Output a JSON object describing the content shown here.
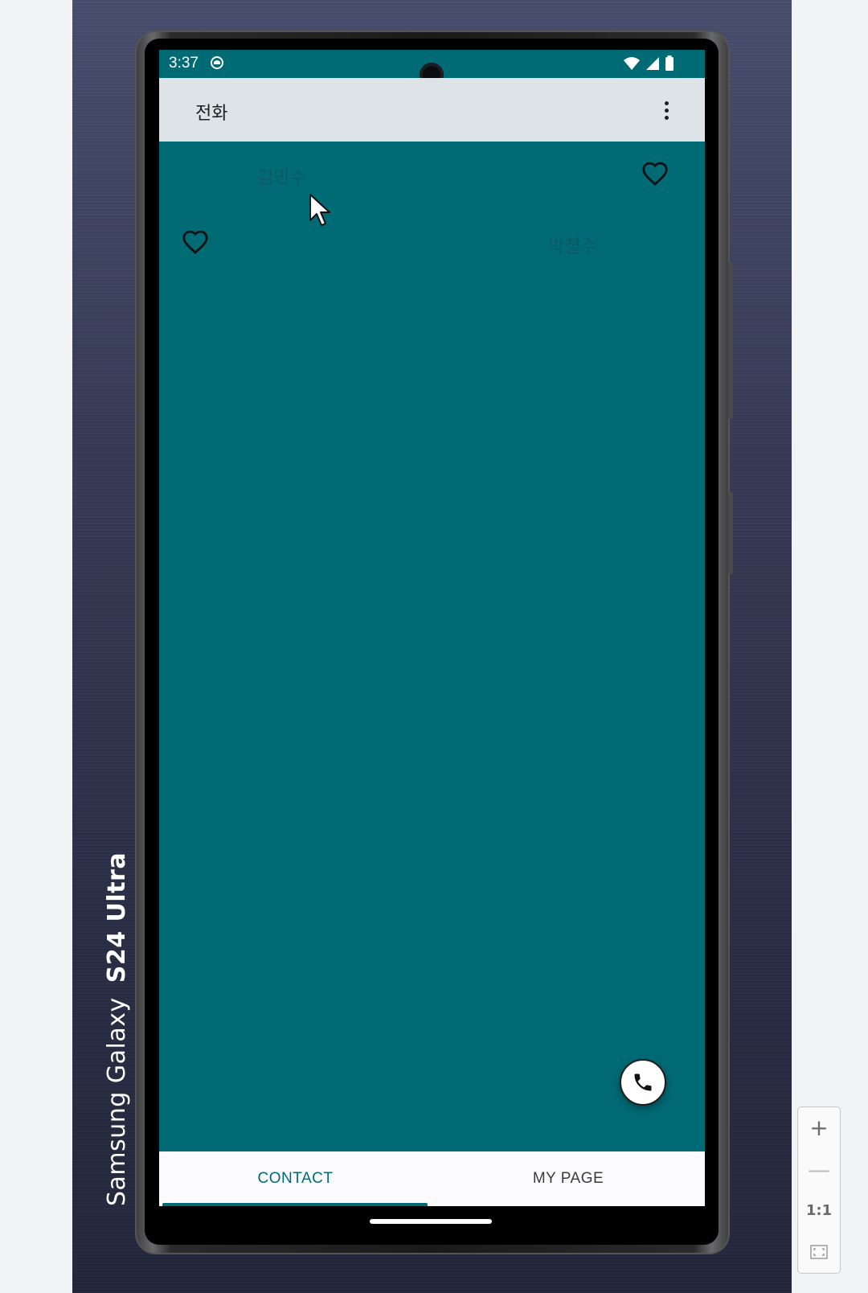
{
  "device": {
    "label_brand": "Samsung Galaxy",
    "label_model": "S24 Ultra"
  },
  "status_bar": {
    "time": "3:37",
    "icons": [
      "app-notification-icon",
      "wifi-icon",
      "signal-icon",
      "battery-icon"
    ]
  },
  "app_bar": {
    "title": "전화",
    "overflow_icon": "more-vert-icon"
  },
  "contacts": [
    {
      "name": "김민수",
      "favorite_icon": "heart-outline-icon"
    },
    {
      "name": "박철수",
      "favorite_icon": "heart-outline-icon"
    }
  ],
  "fab": {
    "icon": "phone-icon"
  },
  "tabs": [
    {
      "label": "CONTACT",
      "selected": true
    },
    {
      "label": "MY PAGE",
      "selected": false
    }
  ],
  "zoom_controls": {
    "zoom_in": "+",
    "zoom_out": "—",
    "actual_size": "1:1",
    "fit_icon": "fit-screen-icon"
  },
  "colors": {
    "primary": "#006a75",
    "app_bar": "#dde3e6",
    "tab_bar": "#fbfbfd"
  }
}
